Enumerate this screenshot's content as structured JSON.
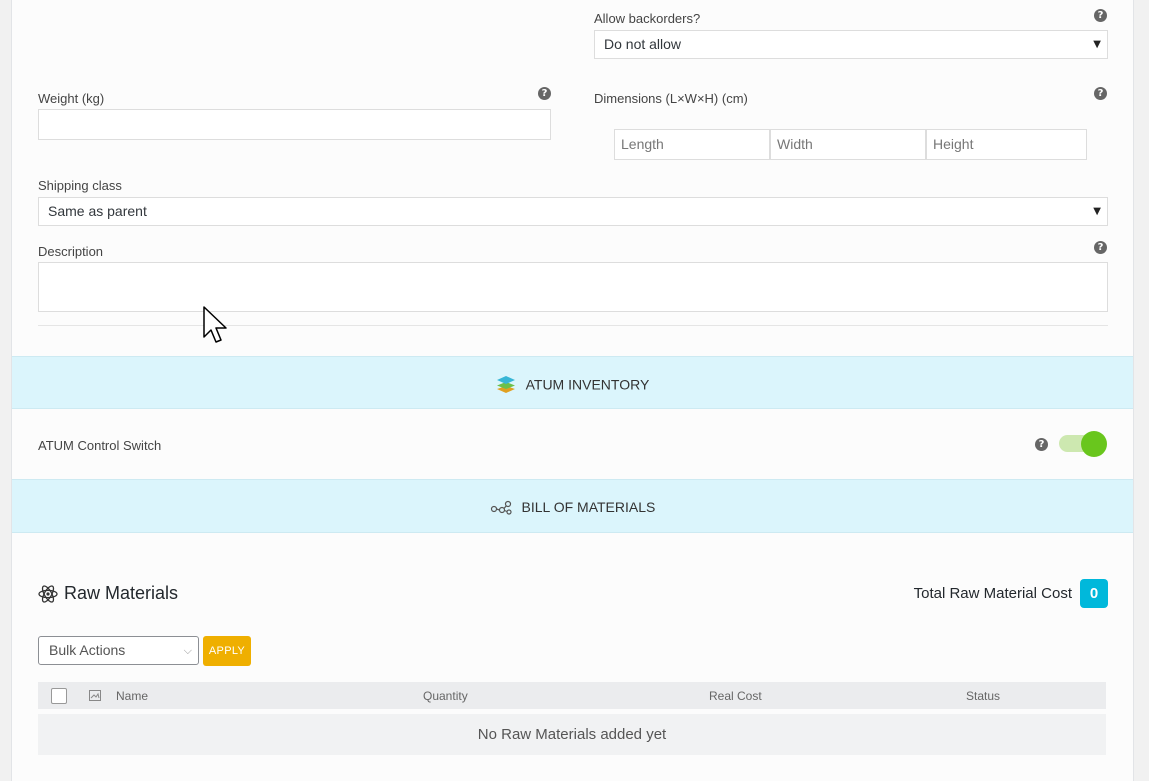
{
  "backorders": {
    "label": "Allow backorders?",
    "value": "Do not allow"
  },
  "weight": {
    "label": "Weight (kg)",
    "value": ""
  },
  "dimensions": {
    "label": "Dimensions (L×W×H) (cm)",
    "length_placeholder": "Length",
    "width_placeholder": "Width",
    "height_placeholder": "Height"
  },
  "shipping": {
    "label": "Shipping class",
    "value": "Same as parent"
  },
  "description": {
    "label": "Description",
    "value": ""
  },
  "help_glyph": "?",
  "atum_inventory": {
    "title": "ATUM INVENTORY",
    "icon": "layers-icon"
  },
  "control_switch": {
    "label": "ATUM Control Switch",
    "enabled": true,
    "color": "#69c61d"
  },
  "bom": {
    "title": "BILL OF MATERIALS",
    "icon": "molecule-icon"
  },
  "raw_materials": {
    "title": "Raw Materials",
    "icon": "atom-icon",
    "total_label": "Total Raw Material Cost",
    "total_value": "0",
    "bulk_actions": "Bulk Actions",
    "apply": "APPLY",
    "columns": [
      "Name",
      "Quantity",
      "Real Cost",
      "Status"
    ],
    "empty_message": "No Raw Materials added yet"
  },
  "colors": {
    "band": "#dbf5fc",
    "badge": "#00b8db",
    "apply": "#efaf00"
  }
}
